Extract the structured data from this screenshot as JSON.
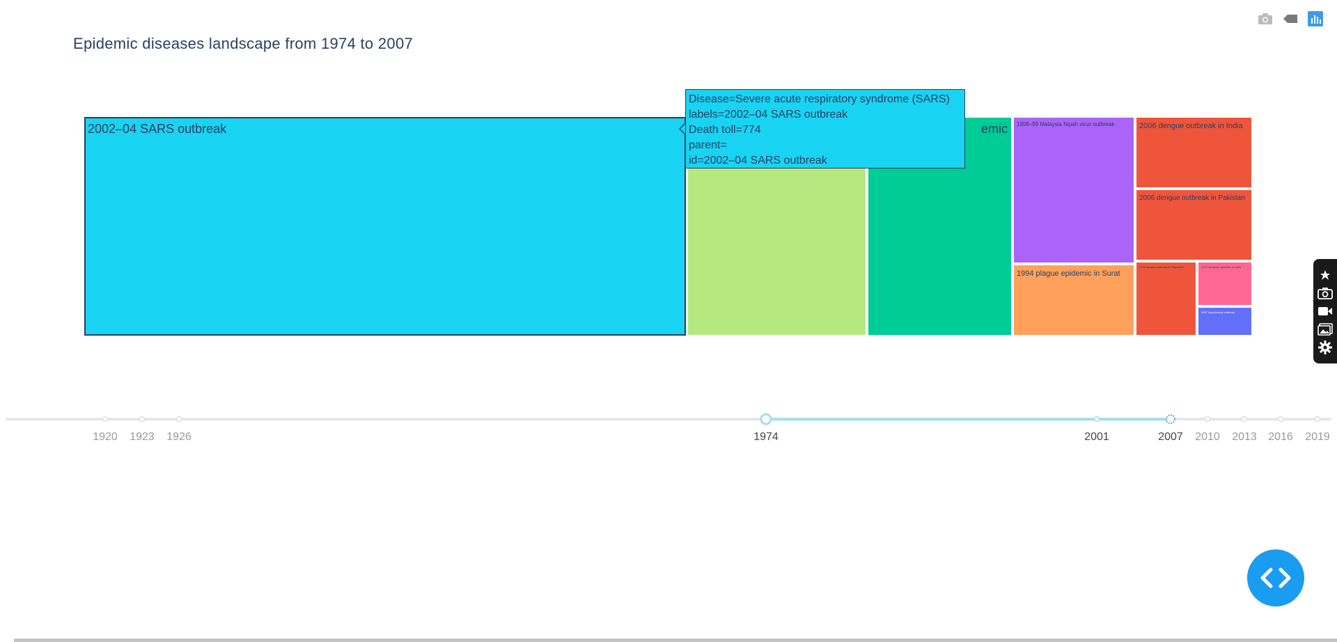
{
  "title": "Epidemic diseases landscape from 1974 to 2007",
  "modebar": [
    {
      "icon": "camera-icon",
      "label": "Download plot as a png"
    },
    {
      "icon": "tag-icon",
      "label": "Show closest data on hover"
    },
    {
      "icon": "plotly-logo-icon",
      "label": "Produced with Plotly"
    }
  ],
  "chart_data": {
    "type": "treemap",
    "title": "Epidemic diseases landscape from 1974 to 2007",
    "value_field": "Death toll",
    "tiles": [
      {
        "label": "2002–04 SARS outbreak",
        "color": "#19d3f3",
        "value": 774,
        "highlighted": true
      },
      {
        "label": "",
        "color": "#b6e880",
        "value": 230
      },
      {
        "label": "emic",
        "color": "#00cc96",
        "value": 185
      },
      {
        "label": "1998–99 Malaysia Nipah virus outbreak",
        "color": "#ab63fa",
        "value": 105
      },
      {
        "label": "1994 plague epidemic in Surat",
        "color": "#ffa15a",
        "value": 52
      },
      {
        "label": "2006 dengue outbreak in India",
        "color": "#ef553b",
        "value": 50
      },
      {
        "label": "2006 dengue outbreak in Pakistan",
        "color": "#ef553b",
        "value": 50
      },
      {
        "label": "2005 dengue outbreak in Singapore",
        "color": "#ef553b",
        "value": 27
      },
      {
        "label": "1974 smallpox epidemic of India",
        "color": "#ff6692",
        "value": 18
      },
      {
        "label": "2007 Iraq cholera outbreak",
        "color": "#636efa",
        "value": 10
      }
    ]
  },
  "tooltip": {
    "lines": [
      "Disease=Severe acute respiratory syndrome (SARS)",
      "labels=2002–04 SARS outbreak",
      "Death toll=774",
      "parent=",
      "id=2002–04 SARS outbreak"
    ]
  },
  "slider": {
    "ticks": [
      "1920",
      "1923",
      "1926",
      "1974",
      "2001",
      "2007",
      "2010",
      "2013",
      "2016",
      "2019"
    ],
    "range_start": "1974",
    "range_end": "2007",
    "track_color": "#e6e6e6",
    "range_color": "#a6dcf2"
  },
  "side_toolbar": [
    {
      "icon": "pin-icon"
    },
    {
      "icon": "camera-icon"
    },
    {
      "icon": "video-icon"
    },
    {
      "icon": "image-gallery-icon"
    },
    {
      "icon": "gear-icon"
    }
  ],
  "code_button": {
    "icon": "code-icon"
  }
}
